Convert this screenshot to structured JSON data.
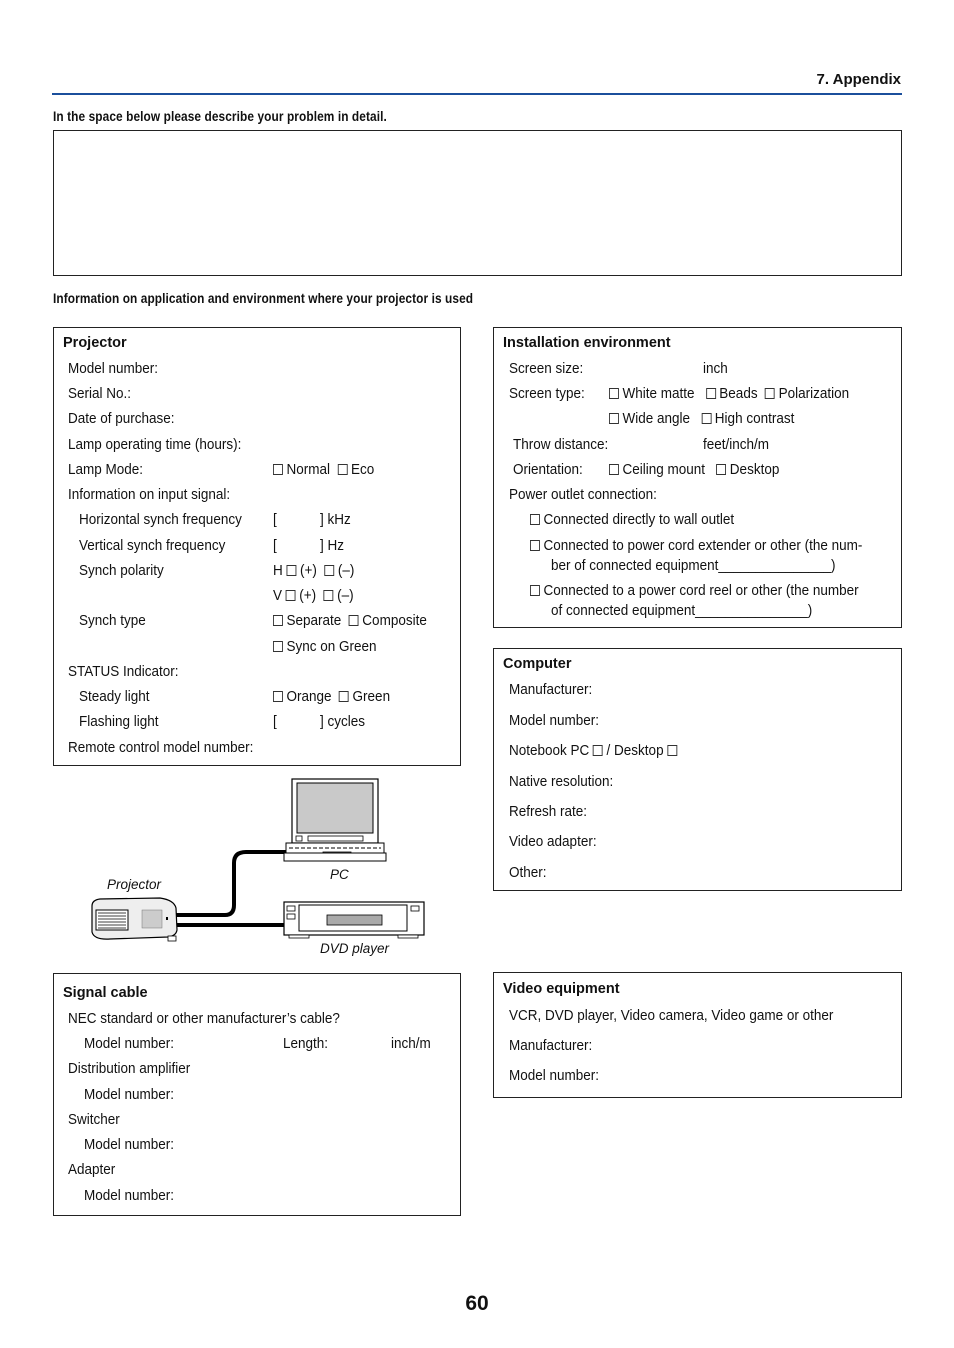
{
  "header": {
    "section_title": "7. Appendix",
    "rule_color": "#1b4f9c"
  },
  "problem": {
    "heading": "In the space below please describe your problem in detail.",
    "text_value": ""
  },
  "info_heading": "Information on application and environment where your projector is used",
  "projector": {
    "title": "Projector",
    "model_number": "Model number:",
    "serial_no": "Serial No.:",
    "date_of_purchase": "Date of purchase:",
    "lamp_time": "Lamp operating time (hours):",
    "lamp_mode": "Lamp Mode:",
    "lamp_mode_options": [
      "Normal",
      "Eco"
    ],
    "input_signal": "Information on input signal:",
    "h_freq": "Horizontal synch frequency",
    "h_freq_open": "[",
    "h_freq_unit": "] kHz",
    "v_freq": "Vertical synch frequency",
    "v_freq_open": "[",
    "v_freq_unit": "] Hz",
    "polarity": "Synch polarity",
    "polarity_h": "H",
    "polarity_v": "V",
    "polarity_plus": "(+)",
    "polarity_minus": "(–)",
    "synch_type": "Synch type",
    "synch_type_options": [
      "Separate",
      "Composite",
      "Sync on Green"
    ],
    "status": "STATUS Indicator:",
    "steady": "Steady light",
    "steady_options": [
      "Orange",
      "Green"
    ],
    "flashing": "Flashing light",
    "flashing_open": "[",
    "flashing_unit": "] cycles",
    "remote": "Remote control model number:"
  },
  "diagram": {
    "projector_label": "Projector",
    "pc_label": "PC",
    "dvd_label": "DVD player"
  },
  "installation": {
    "title": "Installation environment",
    "screen_size": "Screen size:",
    "screen_size_unit": "inch",
    "screen_type": "Screen type:",
    "screen_type_options": [
      "White matte",
      "Beads",
      "Polarization",
      "Wide angle",
      "High contrast"
    ],
    "throw": "Throw distance:",
    "throw_unit": "feet/inch/m",
    "orientation": "Orientation:",
    "orientation_options": [
      "Ceiling mount",
      "Desktop"
    ],
    "power": "Power outlet connection:",
    "power_opt1": "Connected directly to wall outlet",
    "power_opt2_l1": "Connected to power cord extender or other (the num-",
    "power_opt2_l2": "ber of connected equipment_______________)",
    "power_opt3_l1": "Connected to a power cord reel or other (the number",
    "power_opt3_l2": "of connected equipment_______________)"
  },
  "computer": {
    "title": "Computer",
    "manufacturer": "Manufacturer:",
    "model_number": "Model number:",
    "notebook": "Notebook PC",
    "slash_desktop": "/ Desktop",
    "native_res": "Native resolution:",
    "refresh": "Refresh rate:",
    "video_adapter": "Video adapter:",
    "other": "Other:"
  },
  "signal_cable": {
    "title": "Signal cable",
    "nec": "NEC standard or other manufacturer’s cable?",
    "model_number": "Model number:",
    "length": "Length:",
    "length_unit": "inch/m",
    "dist_amp": "Distribution amplifier",
    "switcher": "Switcher",
    "adapter": "Adapter"
  },
  "video": {
    "title": "Video equipment",
    "types": "VCR, DVD player, Video camera, Video game or other",
    "manufacturer": "Manufacturer:",
    "model_number": "Model number:"
  },
  "page_number": "60"
}
